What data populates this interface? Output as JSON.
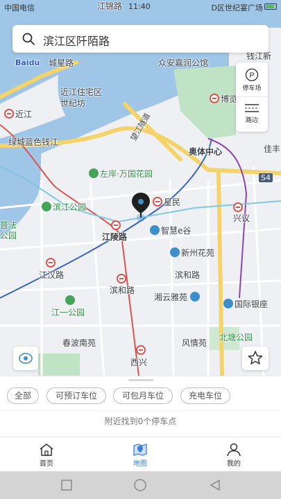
{
  "status_bar": {
    "carrier": "中国电信",
    "time": "11:40",
    "right_text": "D区世纪宴广场"
  },
  "search": {
    "value": "滨江区阡陌路"
  },
  "map": {
    "brand": "Baidu",
    "labels": {
      "jiangjin_road": "江锦路",
      "chengxing_road": "城星路",
      "zhonganjiarun": "众安嘉润公馆",
      "qianjiang_xincheng": "钱江新",
      "jinjiang_zhuzhai": "近江住宅区",
      "shijifang": "世纪坊",
      "bolanzhong": "博览中",
      "jinjiang": "近江",
      "lvcheng_lanse": "绿城蓝色钱江",
      "zuoan_wanguo": "左岸·万国花园",
      "aoti_zhongxin": "奥体中心",
      "jiate": "佳丰",
      "qianjiang_tunnel": "望江隧道",
      "binjiang_park": "滨江公园",
      "xingmin": "星民",
      "xingyi": "兴议",
      "pufa": "普法",
      "park_left": "公园",
      "zhihui_gu": "智慧e谷",
      "jiangling_road": "江陵路",
      "xinzhou_huayuan": "新州花苑",
      "binhe_road_east": "滨和路",
      "jianghan_road": "江汉路",
      "binhe_road": "滨和路",
      "xiangyun_yayuan": "湘云雅苑",
      "guoji_yinzuo": "国际银座",
      "jiangyi_park": "江一公园",
      "beitang_park": "北塘公园",
      "chunbo_nanyuan": "春波南苑",
      "fengqing_yuan": "风情苑",
      "xixing": "西兴",
      "s4": "S4"
    }
  },
  "controls": {
    "parking_label": "停车场",
    "roadside_label": "路边"
  },
  "filters": [
    {
      "label": "全部"
    },
    {
      "label": "可预订车位"
    },
    {
      "label": "可包月车位"
    },
    {
      "label": "充电车位"
    }
  ],
  "summary": "附近找到0个停车点",
  "tabs": [
    {
      "label": "首页",
      "icon": "home-icon",
      "active": false
    },
    {
      "label": "地图",
      "icon": "map-icon",
      "active": true
    },
    {
      "label": "我的",
      "icon": "user-icon",
      "active": false
    }
  ],
  "colors": {
    "water": "#9fc6e6",
    "green": "#bfe3c4",
    "road_main": "#f5d36b",
    "accent": "#3b7fd4",
    "metro_red": "#d9534f"
  }
}
